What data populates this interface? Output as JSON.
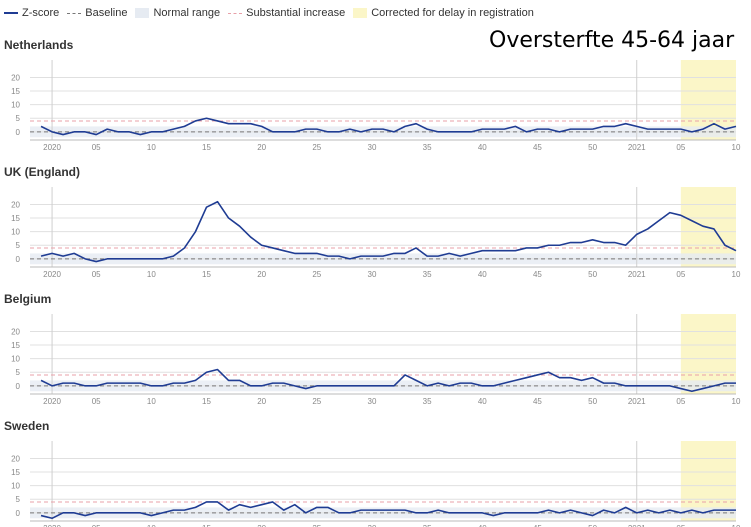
{
  "legend": {
    "zscore": "Z-score",
    "baseline": "Baseline",
    "normal_range": "Normal range",
    "substantial_increase": "Substantial increase",
    "corrected": "Corrected for delay in registration"
  },
  "title": "Oversterfte 45-64 jaar",
  "colors": {
    "zscore": "#1f3c93",
    "baseline": "#777777",
    "normal_range": "#e6ebf2",
    "substantial_increase": "#e8a0a8",
    "corrected": "#fbf6c8",
    "grid": "#e0e0e0"
  },
  "chart_data": [
    {
      "type": "line",
      "title": "Netherlands",
      "ylim": [
        -3,
        22
      ],
      "yticks": [
        0,
        5,
        10,
        15,
        20
      ],
      "x_ticks": [
        "2020",
        "05",
        "10",
        "15",
        "20",
        "25",
        "30",
        "35",
        "40",
        "45",
        "50",
        "2021",
        "05",
        "10"
      ],
      "x_tick_weeks": [
        1,
        5,
        10,
        15,
        20,
        25,
        30,
        35,
        40,
        45,
        50,
        54,
        58,
        63
      ],
      "x_range": [
        -1,
        63
      ],
      "corrected_from_week": 58,
      "baseline": 0,
      "substantial_increase": 4,
      "normal_range": [
        -2,
        2
      ],
      "series": [
        {
          "values": [
            2,
            0,
            -1,
            0,
            0,
            -1,
            1,
            0,
            0,
            -1,
            0,
            0,
            1,
            2,
            4,
            5,
            4,
            3,
            3,
            3,
            2,
            0,
            0,
            0,
            1,
            1,
            0,
            0,
            1,
            0,
            1,
            1,
            0,
            2,
            3,
            1,
            0,
            0,
            0,
            0,
            1,
            1,
            1,
            2,
            0,
            1,
            1,
            0,
            1,
            1,
            1,
            2,
            2,
            3,
            2,
            1,
            1,
            1,
            1,
            0,
            1,
            3,
            1,
            2
          ]
        }
      ]
    },
    {
      "type": "line",
      "title": "UK (England)",
      "ylim": [
        -3,
        22
      ],
      "yticks": [
        0,
        5,
        10,
        15,
        20
      ],
      "x_ticks": [
        "2020",
        "05",
        "10",
        "15",
        "20",
        "25",
        "30",
        "35",
        "40",
        "45",
        "50",
        "2021",
        "05",
        "10"
      ],
      "x_tick_weeks": [
        1,
        5,
        10,
        15,
        20,
        25,
        30,
        35,
        40,
        45,
        50,
        54,
        58,
        63
      ],
      "x_range": [
        -1,
        63
      ],
      "corrected_from_week": 58,
      "baseline": 0,
      "substantial_increase": 4,
      "normal_range": [
        -2,
        2
      ],
      "series": [
        {
          "values": [
            1,
            2,
            1,
            2,
            0,
            -1,
            0,
            0,
            0,
            0,
            0,
            0,
            1,
            4,
            10,
            19,
            21,
            15,
            12,
            8,
            5,
            4,
            3,
            2,
            2,
            2,
            1,
            1,
            0,
            1,
            1,
            1,
            2,
            2,
            4,
            1,
            1,
            2,
            1,
            2,
            3,
            3,
            3,
            3,
            4,
            4,
            5,
            5,
            6,
            6,
            7,
            6,
            6,
            5,
            9,
            11,
            14,
            17,
            16,
            14,
            12,
            11,
            5,
            3
          ]
        }
      ]
    },
    {
      "type": "line",
      "title": "Belgium",
      "ylim": [
        -3,
        22
      ],
      "yticks": [
        0,
        5,
        10,
        15,
        20
      ],
      "x_ticks": [
        "2020",
        "05",
        "10",
        "15",
        "20",
        "25",
        "30",
        "35",
        "40",
        "45",
        "50",
        "2021",
        "05",
        "10"
      ],
      "x_tick_weeks": [
        1,
        5,
        10,
        15,
        20,
        25,
        30,
        35,
        40,
        45,
        50,
        54,
        58,
        63
      ],
      "x_range": [
        -1,
        63
      ],
      "corrected_from_week": 58,
      "baseline": 0,
      "substantial_increase": 4,
      "normal_range": [
        -2,
        2
      ],
      "series": [
        {
          "values": [
            2,
            0,
            1,
            1,
            0,
            0,
            1,
            1,
            1,
            1,
            0,
            0,
            1,
            1,
            2,
            5,
            6,
            2,
            2,
            0,
            0,
            1,
            1,
            0,
            -1,
            0,
            0,
            0,
            0,
            0,
            0,
            0,
            0,
            4,
            2,
            0,
            1,
            0,
            1,
            1,
            0,
            0,
            1,
            2,
            3,
            4,
            5,
            3,
            3,
            2,
            3,
            1,
            1,
            0,
            0,
            0,
            0,
            0,
            -1,
            -2,
            -1,
            0,
            1,
            1
          ]
        }
      ]
    },
    {
      "type": "line",
      "title": "Sweden",
      "ylim": [
        -3,
        22
      ],
      "yticks": [
        0,
        5,
        10,
        15,
        20
      ],
      "x_ticks": [
        "2020",
        "05",
        "10",
        "15",
        "20",
        "25",
        "30",
        "35",
        "40",
        "45",
        "50",
        "2021",
        "05",
        "10"
      ],
      "x_tick_weeks": [
        1,
        5,
        10,
        15,
        20,
        25,
        30,
        35,
        40,
        45,
        50,
        54,
        58,
        63
      ],
      "x_range": [
        -1,
        63
      ],
      "corrected_from_week": 58,
      "baseline": 0,
      "substantial_increase": 4,
      "normal_range": [
        -2,
        2
      ],
      "series": [
        {
          "values": [
            -1,
            -2,
            0,
            0,
            -1,
            0,
            0,
            0,
            0,
            0,
            -1,
            0,
            1,
            1,
            2,
            4,
            4,
            1,
            3,
            2,
            3,
            4,
            1,
            3,
            0,
            2,
            2,
            0,
            0,
            1,
            1,
            1,
            1,
            1,
            0,
            0,
            1,
            0,
            0,
            0,
            0,
            -1,
            0,
            0,
            0,
            0,
            1,
            0,
            1,
            0,
            -1,
            1,
            0,
            2,
            0,
            1,
            0,
            1,
            0,
            1,
            0,
            1,
            1,
            1
          ]
        }
      ]
    }
  ]
}
